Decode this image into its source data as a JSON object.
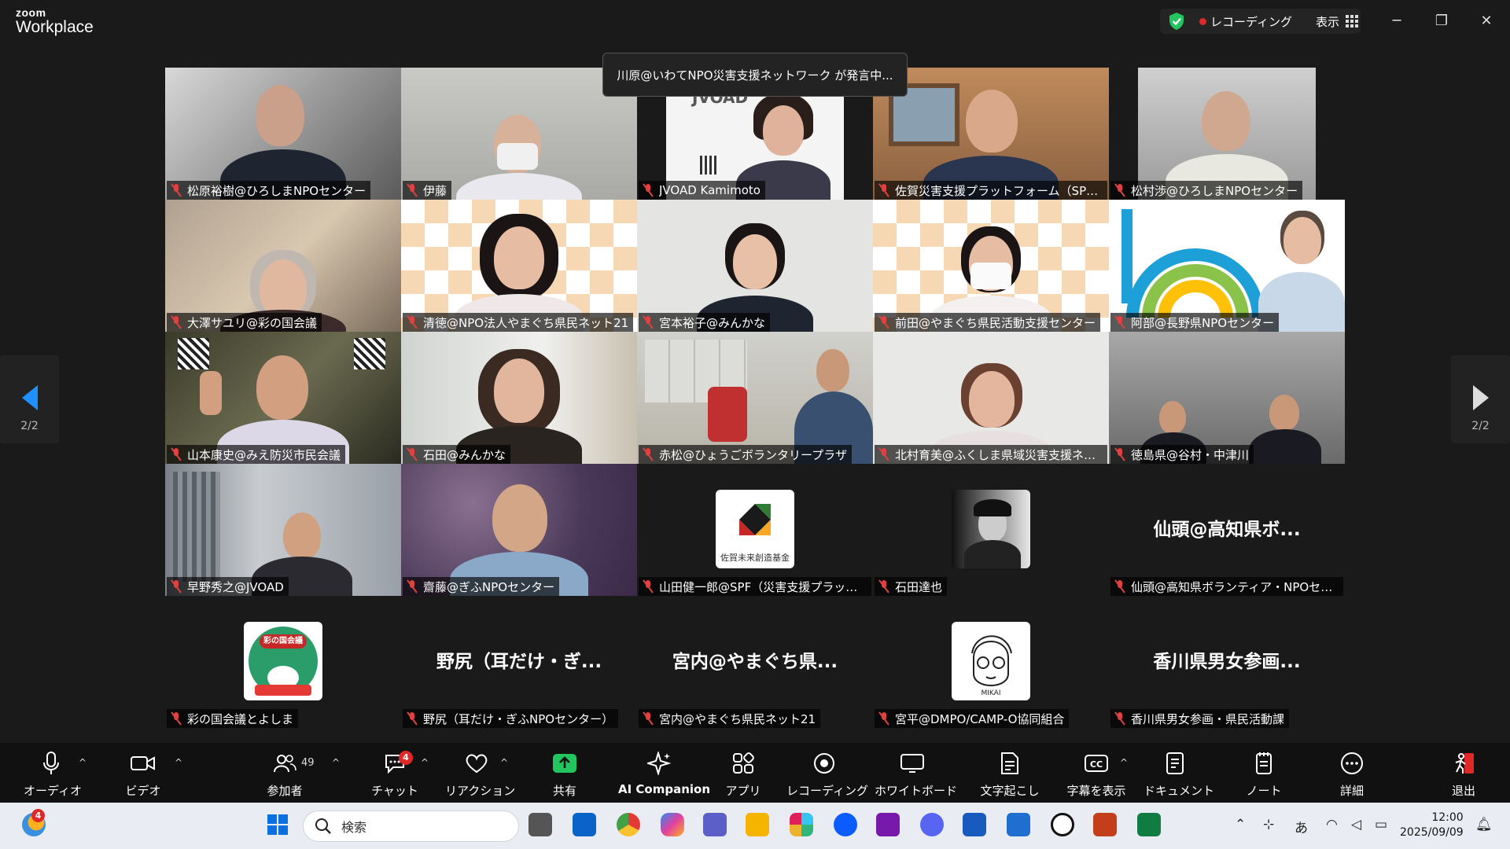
{
  "app": {
    "brand_top": "zoom",
    "brand_bottom": "Workplace"
  },
  "titlebar": {
    "recording_label": "レコーディング",
    "view_label": "表示",
    "minimize": "─",
    "restore": "❐",
    "close": "✕"
  },
  "speaker_notice": "川原@いわてNPO災害支援ネットワーク が発言中...",
  "pagination": {
    "left": "2/2",
    "right": "2/2"
  },
  "participants": [
    {
      "name": "松原裕樹@ひろしまNPOセンター"
    },
    {
      "name": "伊藤"
    },
    {
      "name": "JVOAD Kamimoto",
      "screen_text": "JVOAD"
    },
    {
      "name": "佐賀災害支援プラットフォーム（SPF）"
    },
    {
      "name": "松村渉@ひろしまNPOセンター"
    },
    {
      "name": "大澤サユリ@彩の国会議"
    },
    {
      "name": "清徳@NPO法人やまぐち県民ネット21"
    },
    {
      "name": "宮本裕子@みんかな"
    },
    {
      "name": "前田@やまぐち県民活動支援センター"
    },
    {
      "name": "阿部@長野県NPOセンター"
    },
    {
      "name": "山本康史@みえ防災市民会議"
    },
    {
      "name": "石田@みんかな"
    },
    {
      "name": "赤松@ひょうごボランタリープラザ"
    },
    {
      "name": "北村育美@ふくしま県域災害支援ネット..."
    },
    {
      "name": "徳島県@谷村・中津川"
    },
    {
      "name": "早野秀之@JVOAD"
    },
    {
      "name": "齋藤@ぎふNPOセンター"
    },
    {
      "name": "山田健一郎@SPF（災害支援プラットフ...",
      "avatar_caption": "佐賀未来創造基金"
    },
    {
      "name": "石田達也"
    },
    {
      "name": "仙頭@高知県ボランティア・NPOセンター",
      "display": "仙頭@高知県ボ..."
    },
    {
      "name": "彩の国会議とよしま",
      "avatar_caption": "彩の国会議"
    },
    {
      "name": "野尻（耳だけ・ぎふNPOセンター）",
      "display": "野尻（耳だけ・ぎ..."
    },
    {
      "name": "宮内@やまぐち県民ネット21",
      "display": "宮内@やまぐち県..."
    },
    {
      "name": "宮平@DMPO/CAMP-O協同組合",
      "avatar_caption": "MIKAI"
    },
    {
      "name": "香川県男女参画・県民活動課",
      "display": "香川県男女参画..."
    }
  ],
  "toolbar": {
    "audio": "オーディオ",
    "video": "ビデオ",
    "participants": "参加者",
    "participants_count": "49",
    "chat": "チャット",
    "chat_badge": "4",
    "reactions": "リアクション",
    "share": "共有",
    "ai_companion": "AI Companion",
    "apps": "アプリ",
    "recording": "レコーディング",
    "whiteboard": "ホワイトボード",
    "transcribe": "文字起こし",
    "captions": "字幕を表示",
    "docs": "ドキュメント",
    "notes": "ノート",
    "more": "詳細",
    "leave": "退出"
  },
  "taskbar": {
    "weather_badge": "4",
    "search_placeholder": "検索",
    "ime": "あ",
    "time": "12:00",
    "date": "2025/09/09"
  },
  "colors": {
    "accent": "#0b5cff",
    "share_green": "#22c55e",
    "record_red": "#e02828",
    "toolbar_bg": "#111111"
  }
}
